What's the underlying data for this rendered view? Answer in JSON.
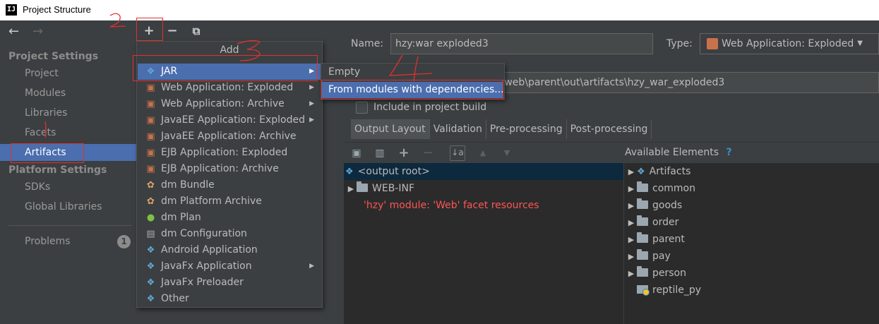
{
  "window": {
    "title": "Project Structure",
    "app_icon": "IJ"
  },
  "sidebar": {
    "project_settings_header": "Project Settings",
    "project_items": [
      {
        "label": "Project"
      },
      {
        "label": "Modules"
      },
      {
        "label": "Libraries"
      },
      {
        "label": "Facets"
      },
      {
        "label": "Artifacts",
        "selected": true
      }
    ],
    "platform_settings_header": "Platform Settings",
    "platform_items": [
      {
        "label": "SDKs"
      },
      {
        "label": "Global Libraries"
      }
    ],
    "problems": {
      "label": "Problems",
      "count": "1"
    }
  },
  "toolbar": {
    "add_glyph": "+",
    "remove_glyph": "−",
    "copy_glyph": "⧉"
  },
  "add_menu": {
    "title": "Add",
    "items": [
      {
        "label": "JAR",
        "icon": "jar-icon",
        "submenu": true,
        "selected": true
      },
      {
        "label": "Web Application: Exploded",
        "icon": "web-app-icon",
        "submenu": true
      },
      {
        "label": "Web Application: Archive",
        "icon": "web-app-archive-icon",
        "submenu": true
      },
      {
        "label": "JavaEE Application: Exploded",
        "icon": "javaee-icon",
        "submenu": true
      },
      {
        "label": "JavaEE Application: Archive",
        "icon": "javaee-archive-icon",
        "submenu": false
      },
      {
        "label": "EJB Application: Exploded",
        "icon": "ejb-icon",
        "submenu": false
      },
      {
        "label": "EJB Application: Archive",
        "icon": "ejb-archive-icon",
        "submenu": false
      },
      {
        "label": "dm Bundle",
        "icon": "dm-bundle-icon",
        "submenu": false
      },
      {
        "label": "dm Platform Archive",
        "icon": "dm-platform-icon",
        "submenu": false
      },
      {
        "label": "dm Plan",
        "icon": "dm-plan-icon",
        "submenu": false
      },
      {
        "label": "dm Configuration",
        "icon": "dm-config-icon",
        "submenu": false
      },
      {
        "label": "Android Application",
        "icon": "android-icon",
        "submenu": false
      },
      {
        "label": "JavaFx Application",
        "icon": "javafx-icon",
        "submenu": true
      },
      {
        "label": "JavaFx Preloader",
        "icon": "javafx-preloader-icon",
        "submenu": false
      },
      {
        "label": "Other",
        "icon": "other-icon",
        "submenu": false
      }
    ]
  },
  "jar_submenu": {
    "items": [
      {
        "label": "Empty",
        "selected": false
      },
      {
        "label": "From modules with dependencies...",
        "selected": true
      }
    ]
  },
  "artifact": {
    "name_label": "Name:",
    "name_value": "hzy:war exploded3",
    "type_label": "Type:",
    "type_value": "Web Application: Exploded",
    "output_dir_value": "e\\web\\parent\\out\\artifacts\\hzy_war_exploded3",
    "include_label": "Include in project build"
  },
  "tabs": [
    {
      "label": "Output Layout",
      "active": true
    },
    {
      "label": "Validation"
    },
    {
      "label": "Pre-processing"
    },
    {
      "label": "Post-processing"
    }
  ],
  "output_tree": [
    {
      "label": "<output root>",
      "icon": "output-root-icon",
      "selected": true
    },
    {
      "label": "WEB-INF",
      "icon": "folder-icon",
      "expandable": true
    },
    {
      "label": "'hzy' module: 'Web' facet resources",
      "icon": "",
      "error": true
    }
  ],
  "available": {
    "header": "Available Elements",
    "help_glyph": "?",
    "items": [
      {
        "label": "Artifacts",
        "icon": "artifacts-icon"
      },
      {
        "label": "common",
        "icon": "folder-icon"
      },
      {
        "label": "goods",
        "icon": "folder-icon"
      },
      {
        "label": "order",
        "icon": "folder-icon"
      },
      {
        "label": "parent",
        "icon": "folder-icon"
      },
      {
        "label": "pay",
        "icon": "folder-icon"
      },
      {
        "label": "person",
        "icon": "folder-icon"
      },
      {
        "label": "reptile_py",
        "icon": "python-folder-icon",
        "leaf": true
      }
    ]
  },
  "annotations": {
    "mark_2": "2",
    "mark_3": "3",
    "mark_4": "4"
  },
  "colors": {
    "selection": "#4b6eaf",
    "error_text": "#ff5555",
    "annotation": "#e03030",
    "help": "#3592c4"
  }
}
